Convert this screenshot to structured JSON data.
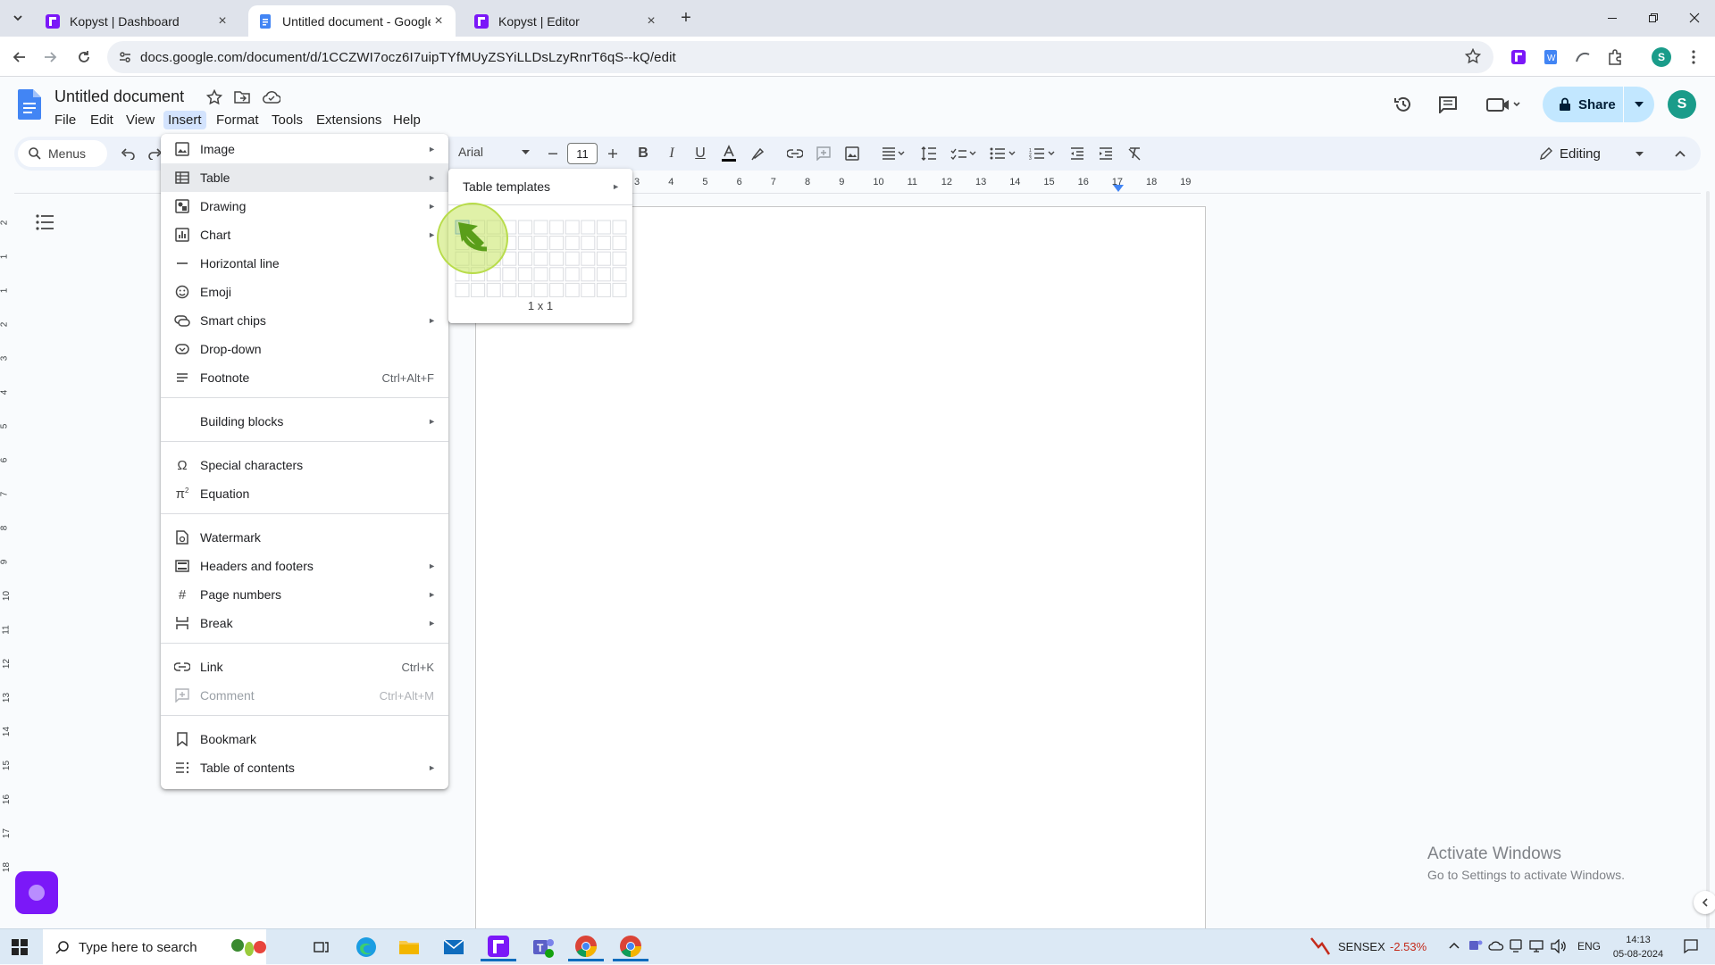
{
  "browser": {
    "tabs": [
      {
        "title": "Kopyst | Dashboard",
        "favicon": "kopyst-icon"
      },
      {
        "title": "Untitled document - Google Do",
        "favicon": "docs-icon"
      },
      {
        "title": "Kopyst | Editor",
        "favicon": "kopyst-icon"
      }
    ],
    "new_tab_label": "+",
    "url": "docs.google.com/document/d/1CCZWI7ocz6I7uipTYfMUyZSYiLLDsLzyRnrT6qS--kQ/edit",
    "profile_initial": "S"
  },
  "docs": {
    "title": "Untitled document",
    "menus": [
      "File",
      "Edit",
      "View",
      "Insert",
      "Format",
      "Tools",
      "Extensions",
      "Help"
    ],
    "share_label": "Share",
    "avatar_initial": "S",
    "toolbar": {
      "menus_search": "Menus",
      "font": "Arial",
      "font_size": "11",
      "mode": "Editing"
    },
    "ruler_ticks": [
      "3",
      "4",
      "5",
      "6",
      "7",
      "8",
      "9",
      "10",
      "11",
      "12",
      "13",
      "14",
      "15",
      "16",
      "17",
      "18",
      "19"
    ],
    "vruler_ticks": [
      "2",
      "1",
      "1",
      "2",
      "3",
      "4",
      "5",
      "6",
      "7",
      "8",
      "9",
      "10",
      "11",
      "12",
      "13",
      "14",
      "15",
      "16",
      "17",
      "18"
    ]
  },
  "insert_menu": {
    "items": [
      {
        "label": "Image",
        "icon": "image-icon",
        "submenu": true
      },
      {
        "label": "Table",
        "icon": "table-icon",
        "submenu": true
      },
      {
        "label": "Drawing",
        "icon": "drawing-icon",
        "submenu": true
      },
      {
        "label": "Chart",
        "icon": "chart-icon",
        "submenu": true
      },
      {
        "label": "Horizontal line",
        "icon": "horizontal-line-icon"
      },
      {
        "label": "Emoji",
        "icon": "emoji-icon"
      },
      {
        "label": "Smart chips",
        "icon": "smart-chips-icon",
        "submenu": true
      },
      {
        "label": "Drop-down",
        "icon": "dropdown-icon"
      },
      {
        "label": "Footnote",
        "icon": "footnote-icon",
        "shortcut": "Ctrl+Alt+F"
      },
      {
        "label": "Building blocks",
        "icon": "building-blocks-icon",
        "submenu": true
      },
      {
        "label": "Special characters",
        "icon": "omega-icon"
      },
      {
        "label": "Equation",
        "icon": "pi-icon"
      },
      {
        "label": "Watermark",
        "icon": "watermark-icon"
      },
      {
        "label": "Headers and footers",
        "icon": "headers-footers-icon",
        "submenu": true
      },
      {
        "label": "Page numbers",
        "icon": "hash-icon",
        "submenu": true
      },
      {
        "label": "Break",
        "icon": "break-icon",
        "submenu": true
      },
      {
        "label": "Link",
        "icon": "link-icon",
        "shortcut": "Ctrl+K"
      },
      {
        "label": "Comment",
        "icon": "comment-icon",
        "shortcut": "Ctrl+Alt+M",
        "disabled": true
      },
      {
        "label": "Bookmark",
        "icon": "bookmark-icon"
      },
      {
        "label": "Table of contents",
        "icon": "toc-icon",
        "submenu": true
      }
    ]
  },
  "table_submenu": {
    "templates_label": "Table templates",
    "grid_columns": 11,
    "grid_rows": 5,
    "selection_label": "1 x 1"
  },
  "watermark": {
    "line1": "Activate Windows",
    "line2": "Go to Settings to activate Windows."
  },
  "taskbar": {
    "search_placeholder": "Type here to search",
    "stock_name": "SENSEX",
    "stock_change": "-2.53%",
    "language": "ENG",
    "time": "14:13",
    "date": "05-08-2024"
  },
  "colors": {
    "accent": "#0b57d0",
    "share_bg": "#c2e7ff",
    "kopyst": "#7b18f8",
    "stock_down": "#c42b1c"
  }
}
